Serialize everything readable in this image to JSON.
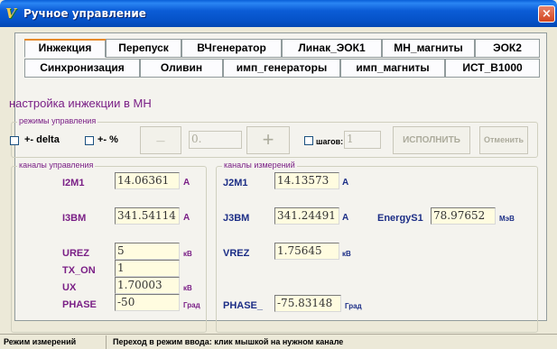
{
  "window": {
    "title": "Ручное управление",
    "close_glyph": "×",
    "icon": "app-logo-icon"
  },
  "tabs_row1": [
    "Инжекция",
    "Перепуск",
    "ВЧгенератор",
    "Линак_ЭОК1",
    "МН_магниты",
    "ЭОК2"
  ],
  "tabs_row2": [
    "Синхронизация",
    "Оливин",
    "имп_генераторы",
    "имп_магниты",
    "ИСТ_В1000"
  ],
  "active_tab": "Инжекция",
  "section_title": "настройка инжекции в МН",
  "modes": {
    "group_label": "режимы управления",
    "delta_label": "+- delta",
    "percent_label": "+- %",
    "minus_label": "_",
    "value_placeholder": "0.",
    "plus_label": "+",
    "steps_label": "шагов:",
    "steps_value": "1",
    "execute_label": "ИСПОЛНИТЬ",
    "cancel_label": "Отменить"
  },
  "control": {
    "group_label": "каналы управления",
    "rows": [
      {
        "label": "I2M1",
        "value": "14.06361",
        "unit": "A"
      },
      {
        "label": "I3BM",
        "value": "341.54114",
        "unit": "A"
      },
      {
        "label": "UREZ",
        "value": "5",
        "unit": "кВ"
      },
      {
        "label": "TX_ON",
        "value": "1",
        "unit": ""
      },
      {
        "label": "UX",
        "value": "1.70003",
        "unit": "кВ"
      },
      {
        "label": "PHASE",
        "value": "-50",
        "unit": "Град"
      }
    ]
  },
  "measure": {
    "group_label": "каналы измерений",
    "j2m1": {
      "label": "J2M1",
      "value": "14.13573",
      "unit": "A"
    },
    "j3bm": {
      "label": "J3BM",
      "value": "341.24491",
      "unit": "A"
    },
    "energy": {
      "label": "EnergyS1",
      "value": "78.97652",
      "unit": "МэВ"
    },
    "vrez": {
      "label": "VREZ",
      "value": "1.75645",
      "unit": "кВ"
    },
    "phase": {
      "label": "PHASE_",
      "value": "-75.83148",
      "unit": "Град"
    }
  },
  "status": {
    "mode": "Режим измерений",
    "hint": "Переход в режим ввода: клик мышкой на нужном канале"
  },
  "colors": {
    "accent_purple": "#7a1f86",
    "accent_navy": "#1c2e86",
    "field_bg": "#fffce0",
    "titlebar": "#0551c6",
    "tab_highlight": "#e68b2c"
  }
}
